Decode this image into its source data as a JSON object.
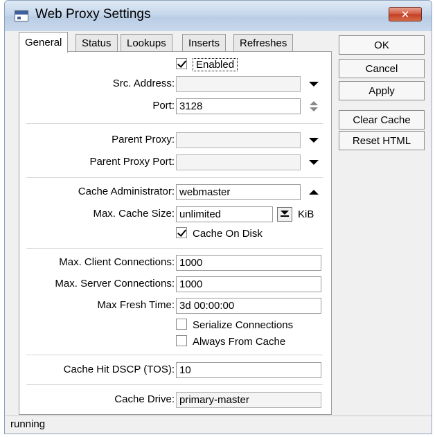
{
  "window": {
    "title": "Web Proxy Settings",
    "close_label": "✕"
  },
  "tabs": [
    "General",
    "Status",
    "Lookups",
    "Inserts",
    "Refreshes"
  ],
  "general": {
    "enabled": {
      "label": "Enabled",
      "checked": true
    },
    "src_address": {
      "label": "Src. Address:",
      "value": ""
    },
    "port": {
      "label": "Port:",
      "value": "3128"
    },
    "parent_proxy": {
      "label": "Parent Proxy:",
      "value": ""
    },
    "parent_proxy_port": {
      "label": "Parent Proxy Port:",
      "value": ""
    },
    "cache_administrator": {
      "label": "Cache Administrator:",
      "value": "webmaster"
    },
    "max_cache_size": {
      "label": "Max. Cache Size:",
      "value": "unlimited",
      "unit": "KiB"
    },
    "cache_on_disk": {
      "label": "Cache On Disk",
      "checked": true
    },
    "max_client_connections": {
      "label": "Max. Client Connections:",
      "value": "1000"
    },
    "max_server_connections": {
      "label": "Max. Server Connections:",
      "value": "1000"
    },
    "max_fresh_time": {
      "label": "Max Fresh Time:",
      "value": "3d 00:00:00"
    },
    "serialize_connections": {
      "label": "Serialize Connections",
      "checked": false
    },
    "always_from_cache": {
      "label": "Always From Cache",
      "checked": false
    },
    "cache_hit_dscp": {
      "label": "Cache Hit DSCP (TOS):",
      "value": "10"
    },
    "cache_drive": {
      "label": "Cache Drive:",
      "value": "primary-master"
    }
  },
  "buttons": {
    "ok": "OK",
    "cancel": "Cancel",
    "apply": "Apply",
    "clear_cache": "Clear Cache",
    "reset_html": "Reset HTML"
  },
  "status": "running"
}
